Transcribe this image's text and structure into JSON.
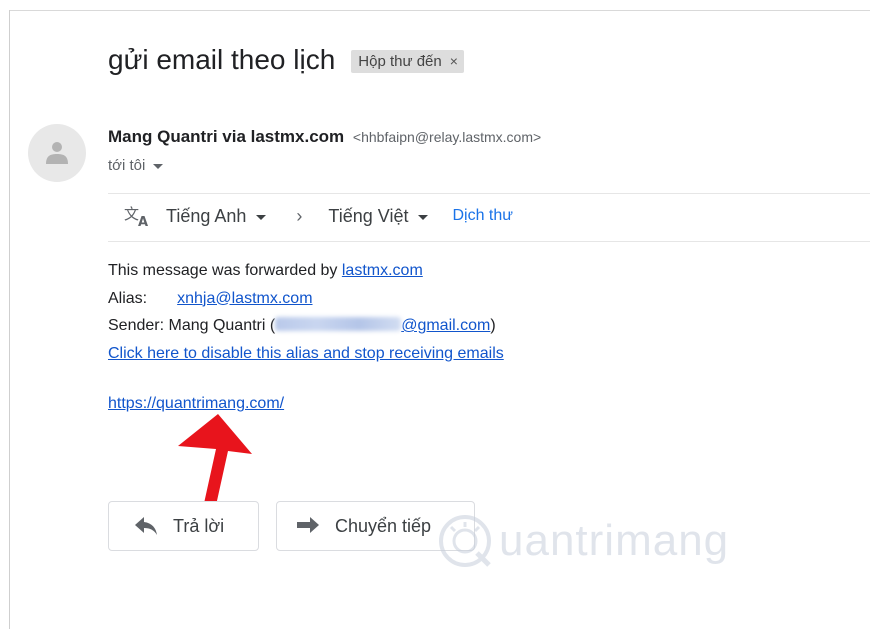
{
  "email": {
    "subject": "gửi email theo lịch",
    "label": "Hộp thư đến",
    "label_close": "×",
    "sender_name": "Mang Quantri via lastmx.com",
    "sender_email": "<hhbfaipn@relay.lastmx.com>",
    "to": "tới tôi"
  },
  "translate_bar": {
    "icon": "translate-icon",
    "from_lang": "Tiếng Anh",
    "separator": "›",
    "to_lang": "Tiếng Việt",
    "action": "Dịch thư"
  },
  "body": {
    "line1_text": "This message was forwarded by ",
    "line1_link": "lastmx.com",
    "alias_label": "Alias:",
    "alias_value": "xnhja@lastmx.com",
    "sender_label": "Sender: Mang Quantri (",
    "sender_email_visible": "@gmail.com",
    "sender_close": ")",
    "disable_link": "Click here to disable this alias and stop receiving emails",
    "site_link": "https://quantrimang.com/"
  },
  "actions": {
    "reply_label": "Trả lời",
    "forward_label": "Chuyển tiếp"
  },
  "watermark": {
    "text": "uantrimang"
  },
  "colors": {
    "link": "#1155cc",
    "translate_link": "#1a73e8",
    "arrow": "#e8141c",
    "label_chip_bg": "#dddddd"
  }
}
